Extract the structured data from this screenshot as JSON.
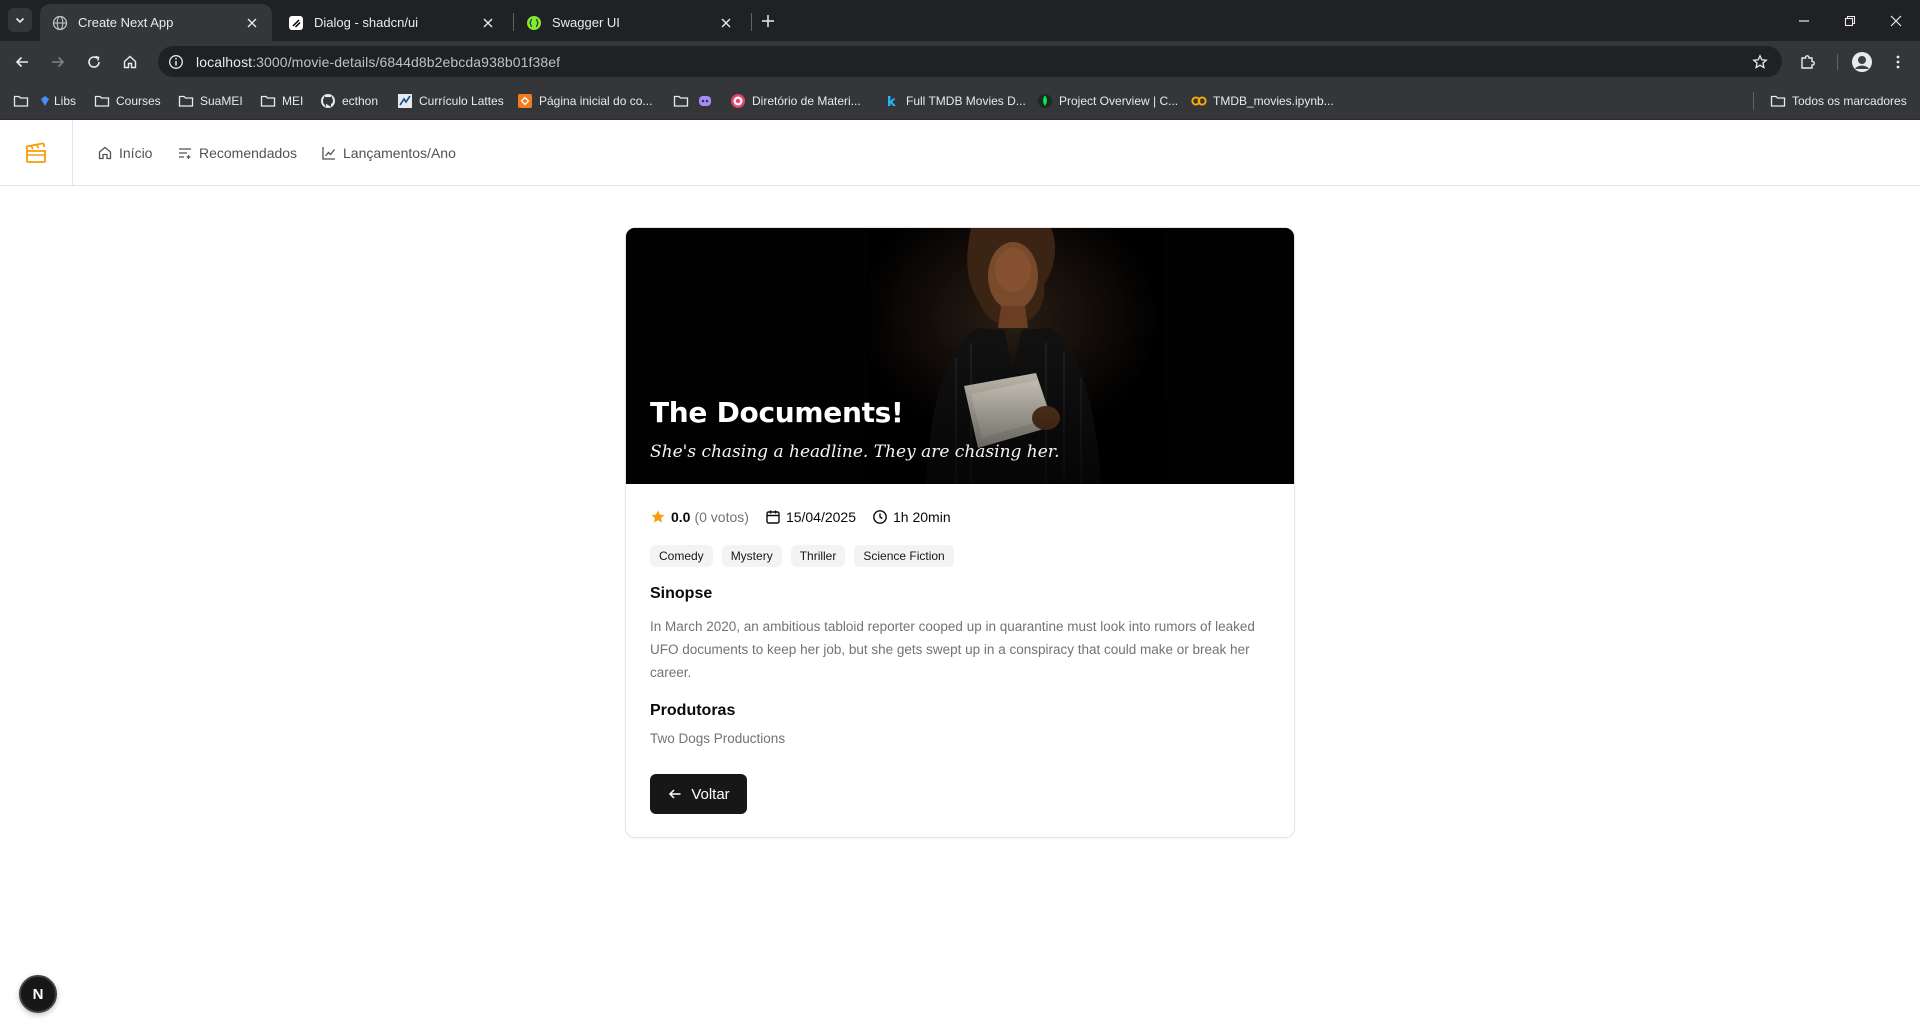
{
  "browser": {
    "tabs": [
      {
        "title": "Create Next App",
        "favicon": "globe-icon",
        "active": true
      },
      {
        "title": "Dialog - shadcn/ui",
        "favicon": "shadcn-icon",
        "active": false
      },
      {
        "title": "Swagger UI",
        "favicon": "swagger-icon",
        "active": false
      }
    ],
    "url_host": "localhost",
    "url_path": ":3000/movie-details/6844d8b2ebcda938b01f38ef",
    "bookmarks": [
      {
        "label": "",
        "icon": "folder-icon"
      },
      {
        "label": "Libs",
        "icon": "libs-icon"
      },
      {
        "label": "Courses",
        "icon": "folder-icon"
      },
      {
        "label": "SuaMEI",
        "icon": "folder-icon"
      },
      {
        "label": "MEI",
        "icon": "folder-icon"
      },
      {
        "label": "ecthon",
        "icon": "github-icon"
      },
      {
        "label": "Currículo Lattes",
        "icon": "lattes-icon"
      },
      {
        "label": "Página inicial do co...",
        "icon": "orange-box-icon"
      },
      {
        "label": "",
        "icon": "folder-icon"
      },
      {
        "label": "",
        "icon": "purple-app-icon"
      },
      {
        "label": "Diretório de Materi...",
        "icon": "target-icon"
      },
      {
        "label": "Full TMDB Movies D...",
        "icon": "kaggle-icon"
      },
      {
        "label": "Project Overview | C...",
        "icon": "mongodb-icon"
      },
      {
        "label": "TMDB_movies.ipynb...",
        "icon": "colab-icon"
      }
    ],
    "all_bookmarks": "Todos os marcadores"
  },
  "nav": {
    "items": [
      {
        "label": "Início",
        "icon": "home-icon"
      },
      {
        "label": "Recomendados",
        "icon": "list-icon"
      },
      {
        "label": "Lançamentos/Ano",
        "icon": "chart-line-icon"
      }
    ]
  },
  "movie": {
    "title": "The Documents!",
    "tagline": "She's chasing a headline. They are chasing her.",
    "rating": "0.0",
    "votes": "(0 votos)",
    "release_date": "15/04/2025",
    "runtime": "1h 20min",
    "genres": [
      "Comedy",
      "Mystery",
      "Thriller",
      "Science Fiction"
    ],
    "synopsis_title": "Sinopse",
    "synopsis": "In March 2020, an ambitious tabloid reporter cooped up in quarantine must look into rumors of leaked UFO documents to keep her job, but she gets swept up in a conspiracy that could make or break her career.",
    "companies_title": "Produtoras",
    "companies": "Two Dogs Productions",
    "back_label": "Voltar"
  },
  "dev_badge": "N",
  "colors": {
    "accent": "#f59e0b",
    "button": "#171717",
    "muted_text": "#737373"
  }
}
